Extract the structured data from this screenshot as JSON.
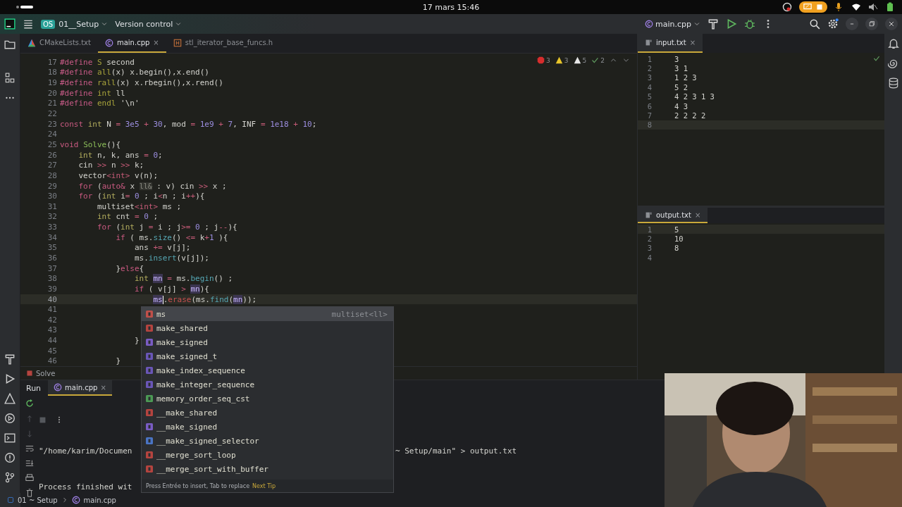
{
  "os_bar": {
    "date": "17 mars 15:46"
  },
  "title_bar": {
    "project_badge": "OS",
    "project": "01__Setup",
    "vcs": "Version control",
    "run_config": "main.cpp"
  },
  "editor_tabs": [
    {
      "label": "CMakeLists.txt",
      "kind": "cmake",
      "selected": false
    },
    {
      "label": "main.cpp",
      "kind": "cpp",
      "selected": true,
      "close": "×"
    },
    {
      "label": "stl_iterator_base_funcs.h",
      "kind": "header",
      "selected": false
    }
  ],
  "inspections": [
    {
      "kind": "error",
      "count": "3"
    },
    {
      "kind": "warning",
      "count": "3"
    },
    {
      "kind": "weak",
      "count": "5"
    },
    {
      "kind": "typo",
      "count": "2"
    }
  ],
  "editor": {
    "lines": [
      {
        "n": "17",
        "current": false,
        "tokens": [
          {
            "t": "#define ",
            "kind": "dir"
          },
          {
            "t": "S",
            "kind": "mac"
          },
          {
            "t": " second",
            "kind": "p"
          }
        ]
      },
      {
        "n": "18",
        "current": false,
        "tokens": [
          {
            "t": "#define ",
            "kind": "dir"
          },
          {
            "t": "all",
            "kind": "mac"
          },
          {
            "t": "(x) x.begin(),x.end()",
            "kind": "p"
          }
        ]
      },
      {
        "n": "19",
        "current": false,
        "tokens": [
          {
            "t": "#define ",
            "kind": "dir"
          },
          {
            "t": "rall",
            "kind": "mac"
          },
          {
            "t": "(x) x.rbegin(),x.rend()",
            "kind": "p"
          }
        ]
      },
      {
        "n": "20",
        "current": false,
        "tokens": [
          {
            "t": "#define ",
            "kind": "dir"
          },
          {
            "t": "int",
            "kind": "mac"
          },
          {
            "t": " ll",
            "kind": "p"
          }
        ]
      },
      {
        "n": "21",
        "current": false,
        "tokens": [
          {
            "t": "#define ",
            "kind": "dir"
          },
          {
            "t": "endl",
            "kind": "mac"
          },
          {
            "t": " '\\n'",
            "kind": "p"
          }
        ]
      },
      {
        "n": "22",
        "current": false
      },
      {
        "n": "23",
        "current": false,
        "tokens": [
          {
            "t": "const ",
            "kind": "kw"
          },
          {
            "t": "int",
            "kind": "type"
          },
          {
            "t": " N ",
            "kind": "p"
          },
          {
            "t": "= ",
            "kind": "op"
          },
          {
            "t": "3e5",
            "kind": "num"
          },
          {
            "t": " + ",
            "kind": "op"
          },
          {
            "t": "30",
            "kind": "num"
          },
          {
            "t": ", mod ",
            "kind": "p"
          },
          {
            "t": "= ",
            "kind": "op"
          },
          {
            "t": "1e9",
            "kind": "num"
          },
          {
            "t": " + ",
            "kind": "op"
          },
          {
            "t": "7",
            "kind": "num"
          },
          {
            "t": ", INF ",
            "kind": "p"
          },
          {
            "t": "= ",
            "kind": "op"
          },
          {
            "t": "1e18",
            "kind": "num"
          },
          {
            "t": " + ",
            "kind": "op"
          },
          {
            "t": "10",
            "kind": "num"
          },
          {
            "t": ";",
            "kind": "p"
          }
        ]
      },
      {
        "n": "24",
        "current": false
      },
      {
        "n": "25",
        "current": false,
        "tokens": [
          {
            "t": "void ",
            "kind": "kw"
          },
          {
            "t": "Solve",
            "kind": "fn"
          },
          {
            "t": "(){",
            "kind": "p"
          }
        ]
      },
      {
        "n": "26",
        "current": false,
        "tokens": [
          {
            "t": "    int",
            "kind": "type"
          },
          {
            "t": " n, k, ans ",
            "kind": "p"
          },
          {
            "t": "= ",
            "kind": "op"
          },
          {
            "t": "0",
            "kind": "num"
          },
          {
            "t": ";",
            "kind": "p"
          }
        ]
      },
      {
        "n": "27",
        "current": false,
        "tokens": [
          {
            "t": "    cin ",
            "kind": "p"
          },
          {
            "t": ">>",
            "kind": "op"
          },
          {
            "t": " n ",
            "kind": "p"
          },
          {
            "t": ">>",
            "kind": "op"
          },
          {
            "t": " k;",
            "kind": "p"
          }
        ]
      },
      {
        "n": "28",
        "current": false,
        "tokens": [
          {
            "t": "    vector",
            "kind": "p"
          },
          {
            "t": "<int>",
            "kind": "op"
          },
          {
            "t": " v(n);",
            "kind": "p"
          }
        ]
      },
      {
        "n": "29",
        "current": false,
        "tokens": [
          {
            "t": "    for",
            "kind": "kw"
          },
          {
            "t": " (",
            "kind": "p"
          },
          {
            "t": "auto&",
            "kind": "kw"
          },
          {
            "t": " x ",
            "kind": "p"
          },
          {
            "t": "ll&",
            "kind": "hint"
          },
          {
            "t": " : v) cin ",
            "kind": "p"
          },
          {
            "t": ">>",
            "kind": "op"
          },
          {
            "t": " x ;",
            "kind": "p"
          }
        ]
      },
      {
        "n": "30",
        "current": false,
        "tokens": [
          {
            "t": "    for",
            "kind": "kw"
          },
          {
            "t": " (",
            "kind": "p"
          },
          {
            "t": "int",
            "kind": "type"
          },
          {
            "t": " i",
            "kind": "p"
          },
          {
            "t": "= ",
            "kind": "op"
          },
          {
            "t": "0",
            "kind": "num"
          },
          {
            "t": " ; i",
            "kind": "p"
          },
          {
            "t": "<",
            "kind": "op"
          },
          {
            "t": "n ; i",
            "kind": "p"
          },
          {
            "t": "++",
            "kind": "op"
          },
          {
            "t": "){",
            "kind": "p"
          }
        ]
      },
      {
        "n": "31",
        "current": false,
        "tokens": [
          {
            "t": "        multiset",
            "kind": "p"
          },
          {
            "t": "<int>",
            "kind": "op"
          },
          {
            "t": " ms ;",
            "kind": "p"
          }
        ]
      },
      {
        "n": "32",
        "current": false,
        "tokens": [
          {
            "t": "        int",
            "kind": "type"
          },
          {
            "t": " cnt ",
            "kind": "p"
          },
          {
            "t": "= ",
            "kind": "op"
          },
          {
            "t": "0",
            "kind": "num"
          },
          {
            "t": " ;",
            "kind": "p"
          }
        ]
      },
      {
        "n": "33",
        "current": false,
        "tokens": [
          {
            "t": "        for",
            "kind": "kw"
          },
          {
            "t": " (",
            "kind": "p"
          },
          {
            "t": "int",
            "kind": "type"
          },
          {
            "t": " j ",
            "kind": "p"
          },
          {
            "t": "= ",
            "kind": "op"
          },
          {
            "t": "i ; j",
            "kind": "p"
          },
          {
            "t": ">= ",
            "kind": "op"
          },
          {
            "t": "0",
            "kind": "num"
          },
          {
            "t": " ; j",
            "kind": "p"
          },
          {
            "t": "--",
            "kind": "op"
          },
          {
            "t": "){",
            "kind": "p"
          }
        ]
      },
      {
        "n": "34",
        "current": false,
        "tokens": [
          {
            "t": "            if",
            "kind": "kw"
          },
          {
            "t": " ( ms.",
            "kind": "p"
          },
          {
            "t": "size",
            "kind": "fn2"
          },
          {
            "t": "() ",
            "kind": "p"
          },
          {
            "t": "<= ",
            "kind": "op"
          },
          {
            "t": "k",
            "kind": "p"
          },
          {
            "t": "+",
            "kind": "op"
          },
          {
            "t": "1",
            "kind": "num"
          },
          {
            "t": " ){",
            "kind": "p"
          }
        ]
      },
      {
        "n": "35",
        "current": false,
        "tokens": [
          {
            "t": "                ans ",
            "kind": "p"
          },
          {
            "t": "+= ",
            "kind": "op"
          },
          {
            "t": "v[j];",
            "kind": "p"
          }
        ]
      },
      {
        "n": "36",
        "current": false,
        "tokens": [
          {
            "t": "                ms.",
            "kind": "p"
          },
          {
            "t": "insert",
            "kind": "fn2"
          },
          {
            "t": "(v[j]);",
            "kind": "p"
          }
        ]
      },
      {
        "n": "37",
        "current": false,
        "tokens": [
          {
            "t": "            }",
            "kind": "p"
          },
          {
            "t": "else",
            "kind": "kw"
          },
          {
            "t": "{",
            "kind": "p"
          }
        ]
      },
      {
        "n": "38",
        "current": false,
        "tokens": [
          {
            "t": "                int ",
            "kind": "type"
          },
          {
            "t": "mn",
            "kind": "var"
          },
          {
            "t": " = ",
            "kind": "op"
          },
          {
            "t": "ms.",
            "kind": "p"
          },
          {
            "t": "begin",
            "kind": "fn2"
          },
          {
            "t": "() ;",
            "kind": "p"
          }
        ]
      },
      {
        "n": "39",
        "current": false,
        "tokens": [
          {
            "t": "                if",
            "kind": "kw"
          },
          {
            "t": " ( v[j] ",
            "kind": "p"
          },
          {
            "t": "> ",
            "kind": "op"
          },
          {
            "t": "mn",
            "kind": "var"
          },
          {
            "t": "){",
            "kind": "p"
          }
        ]
      },
      {
        "n": "40",
        "current": true,
        "tokens": [
          {
            "t": "                    ms",
            "kind": "var"
          },
          {
            "t": ".",
            "kind": "p"
          },
          {
            "t": "erase",
            "kind": "err"
          },
          {
            "t": "(ms.",
            "kind": "p"
          },
          {
            "t": "find",
            "kind": "fn2"
          },
          {
            "t": "(",
            "kind": "p"
          },
          {
            "t": "mn",
            "kind": "var"
          },
          {
            "t": "));",
            "kind": "p"
          }
        ]
      },
      {
        "n": "41",
        "current": false
      },
      {
        "n": "42",
        "current": false
      },
      {
        "n": "43",
        "current": false
      },
      {
        "n": "44",
        "current": false,
        "tokens": [
          {
            "t": "                }",
            "kind": "p"
          }
        ]
      },
      {
        "n": "45",
        "current": false
      },
      {
        "n": "46",
        "current": false,
        "tokens": [
          {
            "t": "            }",
            "kind": "p"
          }
        ]
      }
    ]
  },
  "breadcrumb": "Solve",
  "completion": {
    "items": [
      {
        "label": "ms",
        "kind": "variable",
        "type": "multiset<ll>",
        "selected": true
      },
      {
        "label": "make_shared",
        "kind": "function",
        "selected": false
      },
      {
        "label": "make_signed",
        "kind": "struct",
        "selected": false
      },
      {
        "label": "make_signed_t",
        "kind": "alias",
        "selected": false
      },
      {
        "label": "make_index_sequence",
        "kind": "alias",
        "selected": false
      },
      {
        "label": "make_integer_sequence",
        "kind": "alias",
        "selected": false
      },
      {
        "label": "memory_order_seq_cst",
        "kind": "constant",
        "selected": false
      },
      {
        "label": "__make_shared",
        "kind": "function",
        "selected": false
      },
      {
        "label": "__make_signed",
        "kind": "struct",
        "selected": false
      },
      {
        "label": "__make_signed_selector",
        "kind": "class",
        "selected": false
      },
      {
        "label": "__merge_sort_loop",
        "kind": "function",
        "selected": false
      },
      {
        "label": "__merge_sort_with_buffer",
        "kind": "function",
        "selected": false
      }
    ],
    "hint": "Press Entrée to insert, Tab to replace",
    "tip_link": "Next Tip"
  },
  "input_panel": {
    "tab": "input.txt",
    "close": "×",
    "lines": [
      {
        "n": "1",
        "text": "3",
        "current": false
      },
      {
        "n": "2",
        "text": "3 1",
        "current": false
      },
      {
        "n": "3",
        "text": "1 2 3",
        "current": false
      },
      {
        "n": "4",
        "text": "5 2",
        "current": false
      },
      {
        "n": "5",
        "text": "4 2 3 1 3",
        "current": false
      },
      {
        "n": "6",
        "text": "4 3",
        "current": false
      },
      {
        "n": "7",
        "text": "2 2 2 2",
        "current": false
      },
      {
        "n": "8",
        "current": true
      }
    ]
  },
  "output_panel": {
    "tab": "output.txt",
    "close": "×",
    "lines": [
      {
        "n": "1",
        "text": "5",
        "current": true
      },
      {
        "n": "2",
        "text": "10",
        "current": false
      },
      {
        "n": "3",
        "text": "8",
        "current": false
      },
      {
        "n": "4",
        "current": false
      }
    ]
  },
  "run_panel": {
    "title": "Run",
    "tabs": [
      {
        "label": "main.cpp",
        "selected": true,
        "close": "×"
      }
    ],
    "command_start": "\"/home/karim/Documen",
    "command_end": "~ Setup/main\" > output.txt",
    "exit_line": "Process finished wit"
  },
  "status_bar": {
    "path": [
      "01 ~ Setup",
      "main.cpp"
    ]
  }
}
